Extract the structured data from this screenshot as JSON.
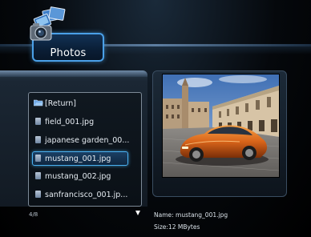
{
  "header": {
    "tab_label": "Photos"
  },
  "file_browser": {
    "items": [
      {
        "label": "[Return]",
        "type": "folder-return",
        "selected": false
      },
      {
        "label": "field_001.jpg",
        "type": "file",
        "selected": false
      },
      {
        "label": "japanese garden_00...",
        "type": "file",
        "selected": false
      },
      {
        "label": "mustang_001.jpg",
        "type": "file",
        "selected": true
      },
      {
        "label": "mustang_002.jpg",
        "type": "file",
        "selected": false
      },
      {
        "label": "sanfrancisco_001.jp...",
        "type": "file",
        "selected": false
      }
    ],
    "page_counter": "4/8"
  },
  "info": {
    "name": "Name: mustang_001.jpg",
    "size": "Size:12 MBytes"
  },
  "colors": {
    "accent": "#4aa0e8",
    "selection": "#4ab0f0"
  }
}
